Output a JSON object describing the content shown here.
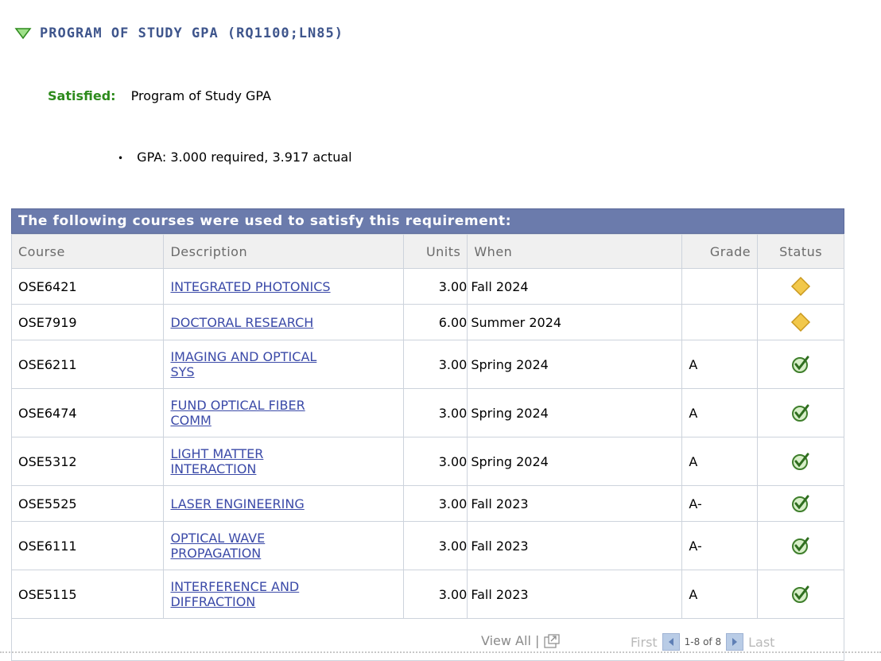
{
  "requirement": {
    "title": "PROGRAM OF STUDY GPA (RQ1100;LN85)",
    "status_label": "Satisfied:",
    "status_text": "Program of Study GPA",
    "gpa_text": "GPA: 3.000 required, 3.917 actual"
  },
  "grid": {
    "caption": "The following courses were used to satisfy this requirement:",
    "columns": [
      "Course",
      "Description",
      "Units",
      "When",
      "Grade",
      "Status"
    ],
    "rows": [
      {
        "course": "OSE6421",
        "description_lines": [
          "INTEGRATED PHOTONICS"
        ],
        "units": "3.00",
        "when": "Fall 2024",
        "grade": "",
        "status_icon": "in-progress-diamond-icon"
      },
      {
        "course": "OSE7919",
        "description_lines": [
          "DOCTORAL RESEARCH"
        ],
        "units": "6.00",
        "when": "Summer 2024",
        "grade": "",
        "status_icon": "in-progress-diamond-icon"
      },
      {
        "course": "OSE6211",
        "description_lines": [
          "IMAGING AND OPTICAL",
          "SYS"
        ],
        "units": "3.00",
        "when": "Spring 2024",
        "grade": "A",
        "status_icon": "completed-check-icon"
      },
      {
        "course": "OSE6474",
        "description_lines": [
          "FUND OPTICAL FIBER",
          "COMM"
        ],
        "units": "3.00",
        "when": "Spring 2024",
        "grade": "A",
        "status_icon": "completed-check-icon"
      },
      {
        "course": "OSE5312",
        "description_lines": [
          "LIGHT MATTER",
          "INTERACTION"
        ],
        "units": "3.00",
        "when": "Spring 2024",
        "grade": "A",
        "status_icon": "completed-check-icon"
      },
      {
        "course": "OSE5525",
        "description_lines": [
          "LASER ENGINEERING"
        ],
        "units": "3.00",
        "when": "Fall 2023",
        "grade": "A-",
        "status_icon": "completed-check-icon"
      },
      {
        "course": "OSE6111",
        "description_lines": [
          "OPTICAL WAVE",
          "PROPAGATION"
        ],
        "units": "3.00",
        "when": "Fall 2023",
        "grade": "A-",
        "status_icon": "completed-check-icon"
      },
      {
        "course": "OSE5115",
        "description_lines": [
          "INTERFERENCE AND",
          "DIFFRACTION"
        ],
        "units": "3.00",
        "when": "Fall 2023",
        "grade": "A",
        "status_icon": "completed-check-icon"
      }
    ],
    "footer": {
      "view_all": "View All |",
      "first": "First",
      "range": "1-8 of 8",
      "last": "Last"
    }
  },
  "colors": {
    "title": "#3e558c",
    "satisfied": "#2e8b1d",
    "caption_bg": "#6b7bac",
    "link": "#3b4aa8",
    "diamond": "#f2c84b",
    "check": "#4ea33a"
  }
}
